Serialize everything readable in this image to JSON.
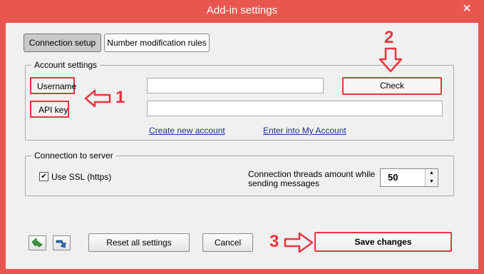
{
  "window": {
    "title": "Add-in settings",
    "close_symbol": "✕"
  },
  "tabs": [
    {
      "label": "Connection setup",
      "active": true
    },
    {
      "label": "Number modification rules",
      "active": false
    }
  ],
  "account": {
    "legend": "Account settings",
    "username_label": "Username",
    "username_value": "",
    "api_key_label": "API key",
    "api_key_value": "",
    "check_label": "Check",
    "create_link": "Create new account",
    "enter_link": "Enter into My Account"
  },
  "connection": {
    "legend": "Connection to server",
    "ssl_label": "Use SSL (https)",
    "ssl_checked": true,
    "threads_label_line1": "Connection threads amount while",
    "threads_label_line2": "sending messages",
    "threads_value": "50"
  },
  "footer": {
    "reset_label": "Reset all settings",
    "cancel_label": "Cancel",
    "save_label": "Save changes"
  },
  "annotations": {
    "step1": "1",
    "step2": "2",
    "step3": "3"
  },
  "colors": {
    "accent": "#e9564f",
    "highlight": "#e8353f",
    "link": "#1a2ea8"
  },
  "icons": [
    "close-icon",
    "import-icon",
    "export-icon",
    "arrow-left-icon",
    "arrow-down-icon",
    "arrow-right-icon",
    "check-mark-icon",
    "spin-up-icon",
    "spin-down-icon"
  ]
}
